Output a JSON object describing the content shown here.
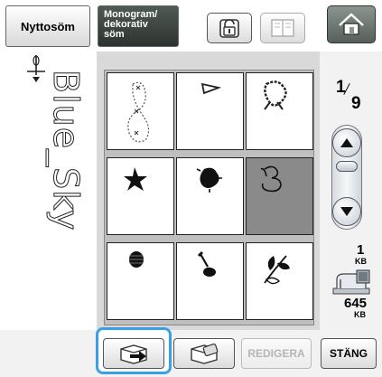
{
  "top_bar": {
    "utility_tab": "Nyttosöm",
    "monogram_tab": [
      "Monogram/",
      "dekorativ",
      "söm"
    ],
    "lock_icon": "lock-icon",
    "book_icon": "book-icon",
    "home_icon": "home-icon"
  },
  "preview": {
    "text": "Blue_Sky",
    "needle_icon": "needle-position-icon"
  },
  "stitch_grid": {
    "cells": [
      {
        "name": "cross-stitch-figure-eight",
        "selected": false
      },
      {
        "name": "arrow-outline",
        "selected": false
      },
      {
        "name": "cross-stitch-flower",
        "selected": false
      },
      {
        "name": "star-burst",
        "selected": false
      },
      {
        "name": "filled-blob",
        "selected": false
      },
      {
        "name": "b-outline",
        "selected": true
      },
      {
        "name": "filled-circle",
        "selected": false
      },
      {
        "name": "musical-note",
        "selected": false
      },
      {
        "name": "leaf-spray",
        "selected": false
      }
    ]
  },
  "pager": {
    "current": "1",
    "total": "9"
  },
  "memory": {
    "used": "1",
    "used_unit": "KB",
    "free": "645",
    "free_unit": "KB"
  },
  "bottom": {
    "retrieve_icon": "retrieve-icon",
    "delete_icon": "delete-icon",
    "edit_label": "REDIGERA",
    "close_label": "STÄNG"
  }
}
